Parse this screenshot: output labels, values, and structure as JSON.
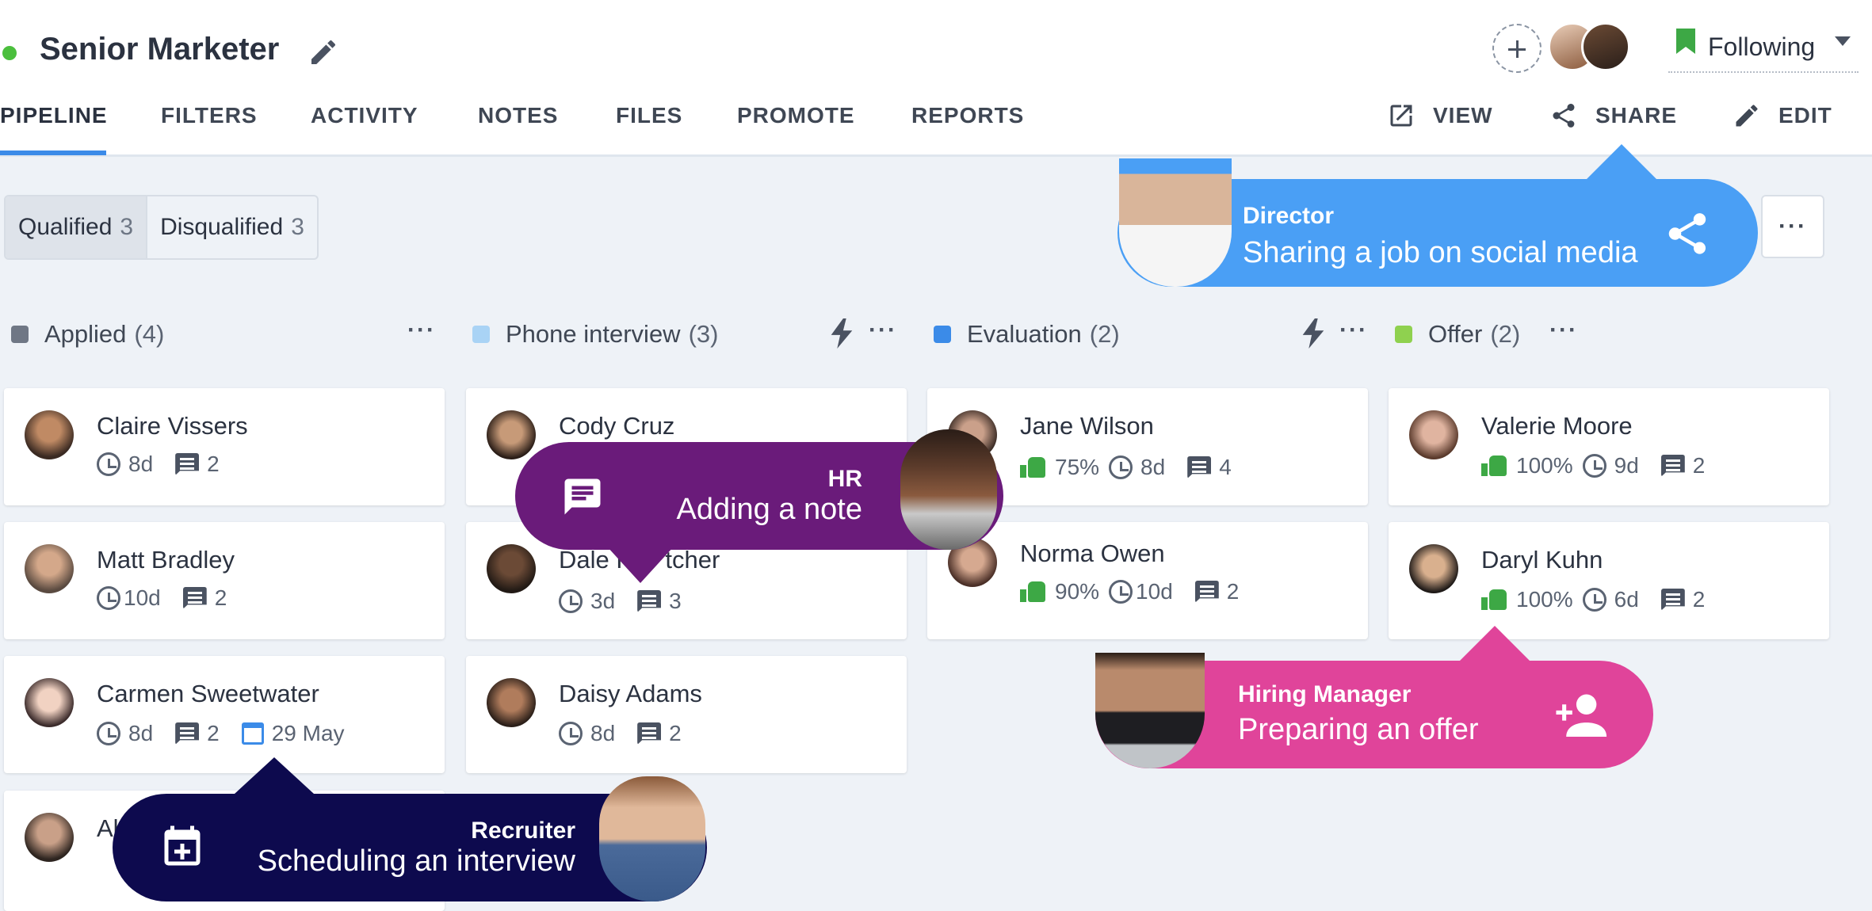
{
  "header": {
    "job_title": "Senior Marketer",
    "following_label": "Following",
    "tabs": [
      "PIPELINE",
      "FILTERS",
      "ACTIVITY",
      "NOTES",
      "FILES",
      "PROMOTE",
      "REPORTS"
    ],
    "actions": {
      "view": "VIEW",
      "share": "SHARE",
      "edit": "EDIT"
    }
  },
  "filter": {
    "qualified_label": "Qualified",
    "qualified_count": "3",
    "disqualified_label": "Disqualified",
    "disqualified_count": "3",
    "more": "···"
  },
  "columns": [
    {
      "name": "Applied",
      "count": "(4)",
      "color": "#6f7785"
    },
    {
      "name": "Phone interview",
      "count": "(3)",
      "color": "#a9d3f5"
    },
    {
      "name": "Evaluation",
      "count": "(2)",
      "color": "#3b8be8"
    },
    {
      "name": "Offer",
      "count": "(2)",
      "color": "#8fd14f"
    }
  ],
  "cards": {
    "applied": [
      {
        "name": "Claire Vissers",
        "time": "8d",
        "comments": "2"
      },
      {
        "name": "Matt Bradley",
        "time": "10d",
        "comments": "2"
      },
      {
        "name": "Carmen Sweetwater",
        "time": "8d",
        "comments": "2",
        "date": "29 May"
      },
      {
        "name": "Al"
      }
    ],
    "phone": [
      {
        "name": "Cody Cruz"
      },
      {
        "name": "Dale F     tcher",
        "time": "3d",
        "comments": "3"
      },
      {
        "name": "Daisy Adams",
        "time": "8d",
        "comments": "2"
      }
    ],
    "evaluation": [
      {
        "name": "Jane Wilson",
        "score": "75%",
        "time": "8d",
        "comments": "4"
      },
      {
        "name": "Norma Owen",
        "score": "90%",
        "time": "10d",
        "comments": "2"
      }
    ],
    "offer": [
      {
        "name": "Valerie Moore",
        "score": "100%",
        "time": "9d",
        "comments": "2"
      },
      {
        "name": "Daryl Kuhn",
        "score": "100%",
        "time": "6d",
        "comments": "2"
      }
    ]
  },
  "tooltips": {
    "director": {
      "role": "Director",
      "action": "Sharing a job on social media",
      "color": "#4a9ff5"
    },
    "hr": {
      "role": "HR",
      "action": "Adding a note",
      "color": "#6a1b7a"
    },
    "hiring": {
      "role": "Hiring Manager",
      "action": "Preparing an offer",
      "color": "#e0449a"
    },
    "recruiter": {
      "role": "Recruiter",
      "action": "Scheduling an interview",
      "color": "#0d0a4e"
    }
  },
  "icons": [
    "pencil-icon",
    "add-person-icon",
    "bookmark-icon",
    "external-link-icon",
    "share-icon",
    "edit-icon",
    "clock-icon",
    "comment-icon",
    "calendar-icon",
    "thumbs-up-icon",
    "bolt-icon",
    "note-icon",
    "calendar-plus-icon",
    "person-add-icon"
  ]
}
